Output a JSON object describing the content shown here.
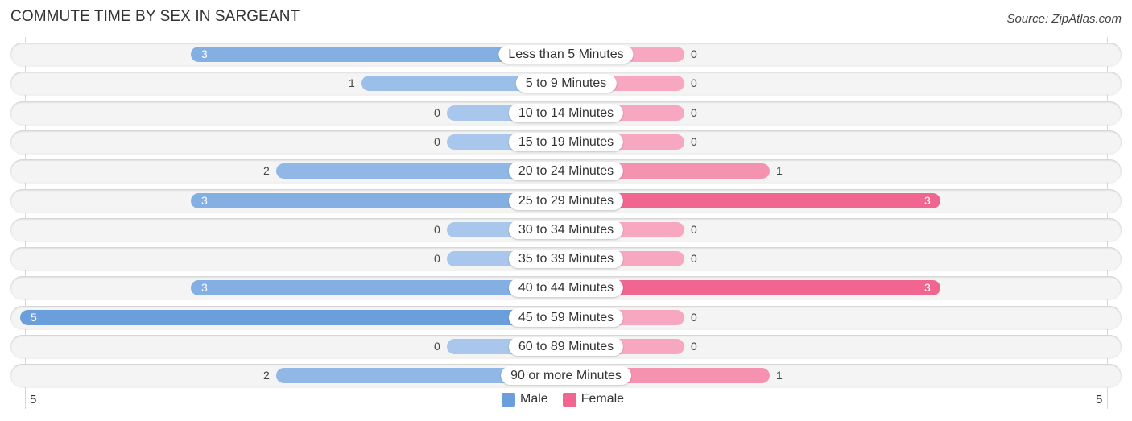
{
  "title": "COMMUTE TIME BY SEX IN SARGEANT",
  "source": "Source: ZipAtlas.com",
  "colors": {
    "male": "#6a9fdc",
    "male_light": "#a9c7ec",
    "female": "#f06691",
    "female_light": "#f7a8c0"
  },
  "chart_data": {
    "type": "bar",
    "orientation": "horizontal-diverging",
    "title": "COMMUTE TIME BY SEX IN SARGEANT",
    "categories": [
      "Less than 5 Minutes",
      "5 to 9 Minutes",
      "10 to 14 Minutes",
      "15 to 19 Minutes",
      "20 to 24 Minutes",
      "25 to 29 Minutes",
      "30 to 34 Minutes",
      "35 to 39 Minutes",
      "40 to 44 Minutes",
      "45 to 59 Minutes",
      "60 to 89 Minutes",
      "90 or more Minutes"
    ],
    "series": [
      {
        "name": "Male",
        "values": [
          3,
          1,
          0,
          0,
          2,
          3,
          0,
          0,
          3,
          5,
          0,
          2
        ]
      },
      {
        "name": "Female",
        "values": [
          0,
          0,
          0,
          0,
          1,
          3,
          0,
          0,
          3,
          0,
          0,
          1
        ]
      }
    ],
    "xlim": [
      5,
      5
    ],
    "axis_tick_left": "5",
    "axis_tick_right": "5",
    "legend": [
      "Male",
      "Female"
    ],
    "legend_position": "bottom-center"
  }
}
